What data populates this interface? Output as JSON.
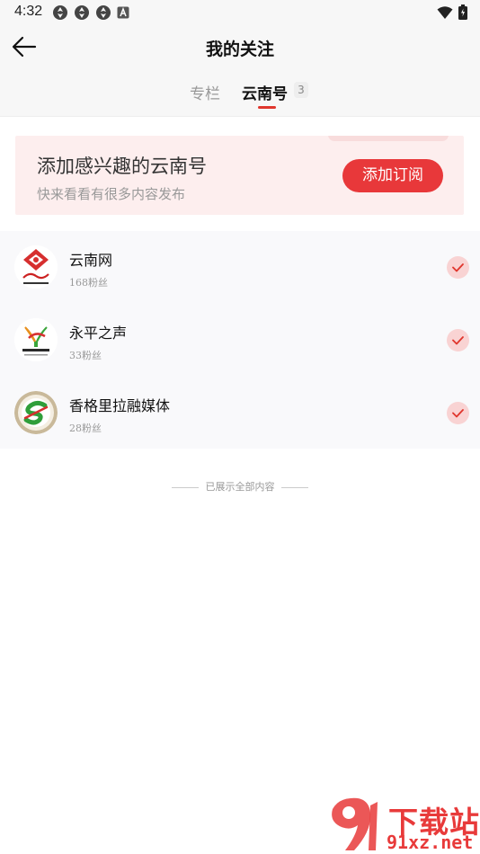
{
  "status_bar": {
    "time": "4:32",
    "left_icons": [
      "app-notification-icon",
      "app-notification-icon",
      "app-notification-icon",
      "text-a-icon"
    ],
    "right_icons": [
      "wifi-icon",
      "battery-icon"
    ]
  },
  "header": {
    "title": "我的关注",
    "back_icon": "arrow-left-icon"
  },
  "tabs": {
    "items": [
      {
        "label": "专栏",
        "active": false
      },
      {
        "label": "云南号",
        "active": true,
        "count": "3"
      }
    ],
    "accent_color": "#e0362d"
  },
  "banner": {
    "title": "添加感兴趣的云南号",
    "subtitle": "快来看看有很多内容发布",
    "button_label": "添加订阅",
    "button_color": "#e8383a",
    "background_color": "#fdeeee"
  },
  "follow_list": [
    {
      "name": "云南网",
      "fans": "168粉丝",
      "avatar_icon": "yunnan-net-logo-icon",
      "followed": true
    },
    {
      "name": "永平之声",
      "fans": "33粉丝",
      "avatar_icon": "yongping-logo-icon",
      "followed": true
    },
    {
      "name": "香格里拉融媒体",
      "fans": "28粉丝",
      "avatar_icon": "shangri-la-media-logo-icon",
      "followed": true
    }
  ],
  "end_note": "已展示全部内容",
  "watermark": {
    "line1": "下载站",
    "line2": "91xz.net"
  }
}
